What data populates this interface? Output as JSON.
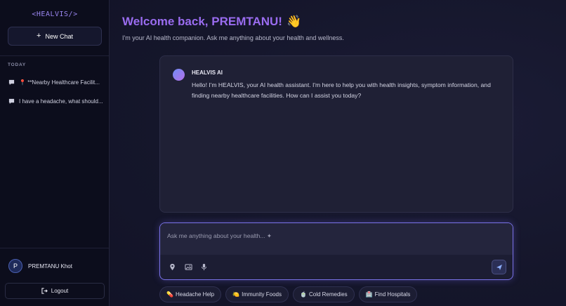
{
  "sidebar": {
    "logo": "<HEALVIS/>",
    "new_chat_label": "New Chat",
    "section_label": "TODAY",
    "history": [
      {
        "icon": "📍",
        "label": "**Nearby Healthcare Facilit..."
      },
      {
        "icon": "",
        "label": "I have a headache, what should..."
      }
    ],
    "user": {
      "initial": "P",
      "name": "PREMTANU Khot"
    },
    "logout_label": "Logout"
  },
  "main": {
    "welcome_text": "Welcome back, PREMTANU!",
    "welcome_emoji": "👋",
    "subtitle": "I'm your AI health companion. Ask me anything about your health and wellness.",
    "assistant": {
      "name": "HEALVIS AI",
      "message": "Hello! I'm HEALVIS, your AI health assistant. I'm here to help you with health insights, symptom information, and finding nearby healthcare facilities. How can I assist you today?"
    },
    "input": {
      "placeholder": "Ask me anything about your health... ✦",
      "value": ""
    },
    "chips": [
      {
        "emoji": "💊",
        "label": "Headache Help"
      },
      {
        "emoji": "🍋",
        "label": "Immunity Foods"
      },
      {
        "emoji": "🍵",
        "label": "Cold Remedies"
      },
      {
        "emoji": "🏥",
        "label": "Find Hospitals"
      }
    ]
  },
  "colors": {
    "accent": "#9a6cf0",
    "sidebar_bg": "#0c0d1c",
    "main_bg": "#15162b",
    "input_border": "#7a72e8"
  },
  "icons": {
    "new_chat": "plus-icon",
    "history": "chat-bubble-icon",
    "logout": "logout-icon",
    "tools": [
      "location-pin-icon",
      "image-icon",
      "microphone-icon"
    ],
    "send": "send-icon"
  }
}
